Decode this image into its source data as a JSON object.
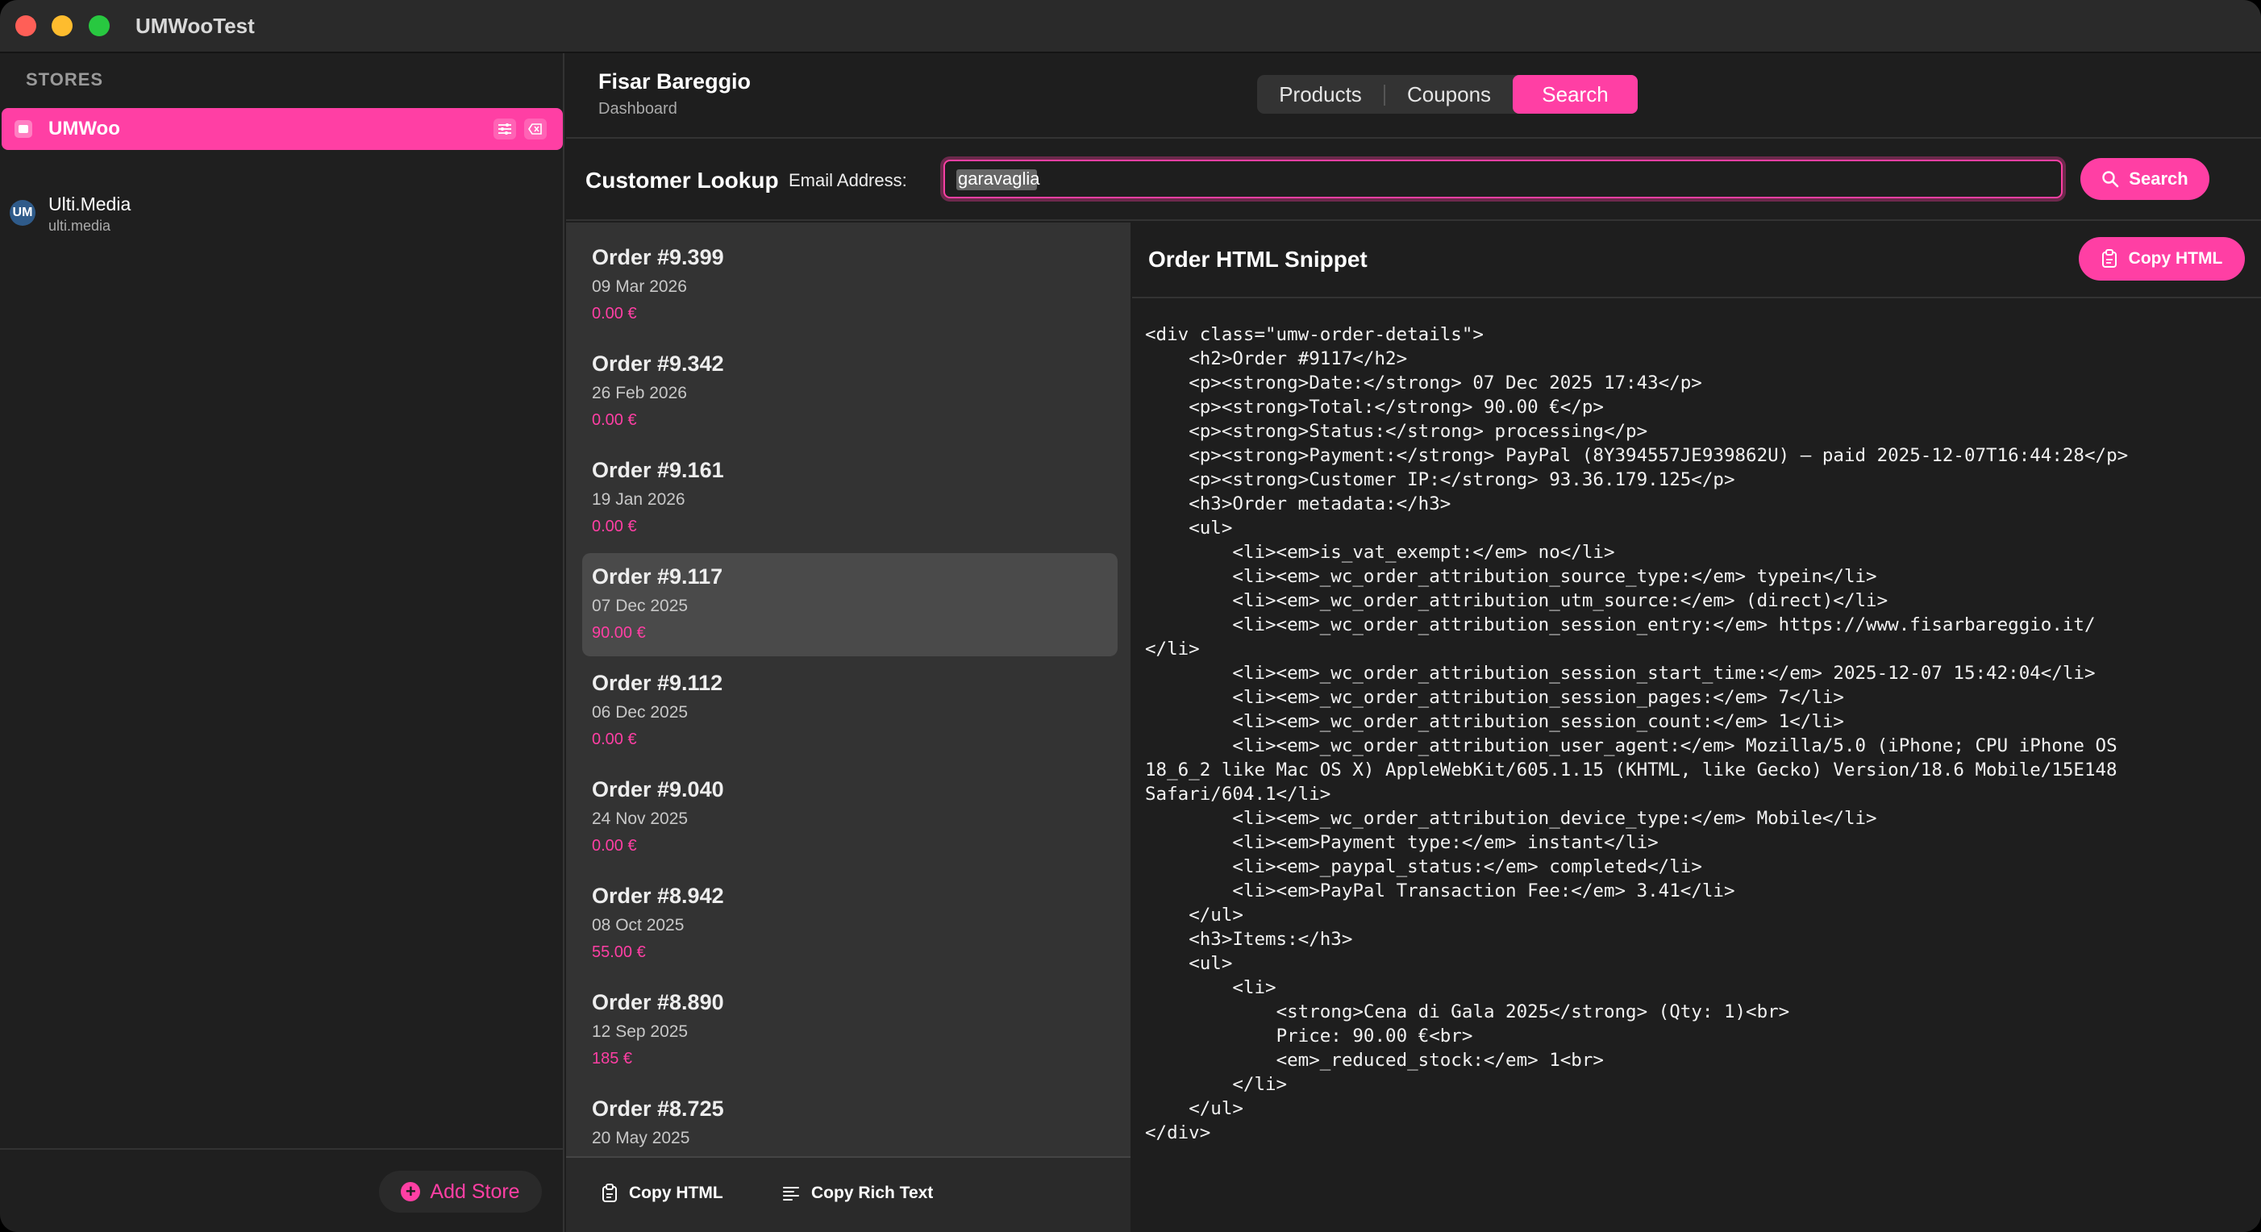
{
  "app": {
    "title": "UMWooTest"
  },
  "sidebar": {
    "header": "STORES",
    "stores": [
      {
        "name": "UMWoo",
        "active": true
      },
      {
        "name": "Ulti.Media",
        "url": "ulti.media",
        "logo_text": "UM"
      }
    ],
    "add_store_label": "Add Store"
  },
  "header": {
    "title": "Fisar Bareggio",
    "subtitle": "Dashboard",
    "tabs": [
      {
        "label": "Products"
      },
      {
        "label": "Coupons"
      },
      {
        "label": "Search",
        "active": true
      }
    ]
  },
  "lookup": {
    "title": "Customer Lookup",
    "email_label": "Email Address:",
    "email_value": "garavaglia",
    "search_label": "Search"
  },
  "orders": [
    {
      "number": "Order #9.399",
      "date": "09 Mar 2026",
      "total": "0.00 €"
    },
    {
      "number": "Order #9.342",
      "date": "26 Feb 2026",
      "total": "0.00 €"
    },
    {
      "number": "Order #9.161",
      "date": "19 Jan 2026",
      "total": "0.00 €"
    },
    {
      "number": "Order #9.117",
      "date": "07 Dec 2025",
      "total": "90.00 €",
      "selected": true
    },
    {
      "number": "Order #9.112",
      "date": "06 Dec 2025",
      "total": "0.00 €"
    },
    {
      "number": "Order #9.040",
      "date": "24 Nov 2025",
      "total": "0.00 €"
    },
    {
      "number": "Order #8.942",
      "date": "08 Oct 2025",
      "total": "55.00 €"
    },
    {
      "number": "Order #8.890",
      "date": "12 Sep 2025",
      "total": "185 €"
    },
    {
      "number": "Order #8.725",
      "date": "20 May 2025",
      "total": ""
    }
  ],
  "orders_footer": {
    "copy_html_label": "Copy HTML",
    "copy_rich_label": "Copy Rich Text"
  },
  "snippet": {
    "title": "Order HTML Snippet",
    "copy_label": "Copy HTML",
    "code": "<div class=\"umw-order-details\">\n    <h2>Order #9117</h2>\n    <p><strong>Date:</strong> 07 Dec 2025 17:43</p>\n    <p><strong>Total:</strong> 90.00 €</p>\n    <p><strong>Status:</strong> processing</p>\n    <p><strong>Payment:</strong> PayPal (8Y394557JE939862U) — paid 2025-12-07T16:44:28</p>\n    <p><strong>Customer IP:</strong> 93.36.179.125</p>\n    <h3>Order metadata:</h3>\n    <ul>\n        <li><em>is_vat_exempt:</em> no</li>\n        <li><em>_wc_order_attribution_source_type:</em> typein</li>\n        <li><em>_wc_order_attribution_utm_source:</em> (direct)</li>\n        <li><em>_wc_order_attribution_session_entry:</em> https://www.fisarbareggio.it/\n</li>\n        <li><em>_wc_order_attribution_session_start_time:</em> 2025-12-07 15:42:04</li>\n        <li><em>_wc_order_attribution_session_pages:</em> 7</li>\n        <li><em>_wc_order_attribution_session_count:</em> 1</li>\n        <li><em>_wc_order_attribution_user_agent:</em> Mozilla/5.0 (iPhone; CPU iPhone OS\n18_6_2 like Mac OS X) AppleWebKit/605.1.15 (KHTML, like Gecko) Version/18.6 Mobile/15E148\nSafari/604.1</li>\n        <li><em>_wc_order_attribution_device_type:</em> Mobile</li>\n        <li><em>Payment type:</em> instant</li>\n        <li><em>_paypal_status:</em> completed</li>\n        <li><em>PayPal Transaction Fee:</em> 3.41</li>\n    </ul>\n    <h3>Items:</h3>\n    <ul>\n        <li>\n            <strong>Cena di Gala 2025</strong> (Qty: 1)<br>\n            Price: 90.00 €<br>\n            <em>_reduced_stock:</em> 1<br>\n        </li>\n    </ul>\n</div>"
  },
  "colors": {
    "accent": "#ff3fa4",
    "background": "#1e1e1e",
    "list_bg": "#333333"
  }
}
